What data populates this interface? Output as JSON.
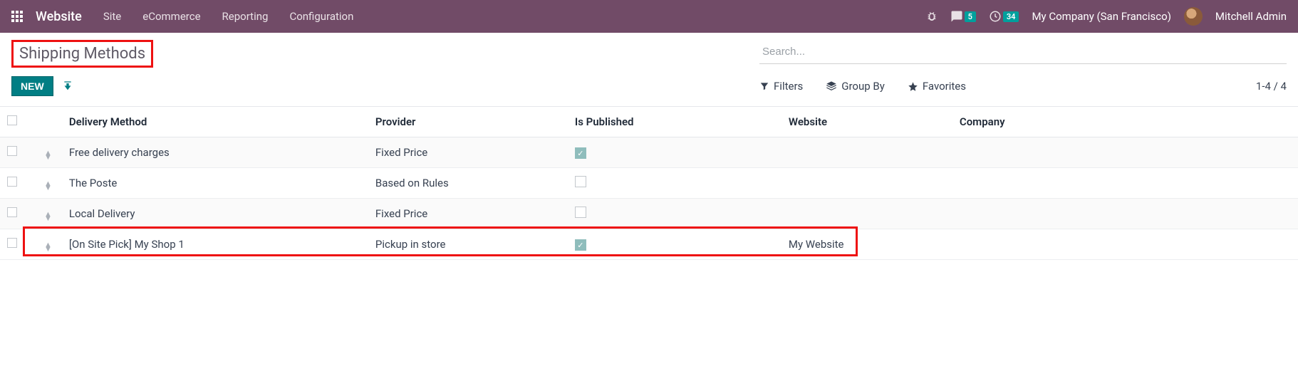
{
  "nav": {
    "brand": "Website",
    "items": [
      "Site",
      "eCommerce",
      "Reporting",
      "Configuration"
    ],
    "msg_badge": "5",
    "act_badge": "34",
    "company": "My Company (San Francisco)",
    "user": "Mitchell Admin"
  },
  "breadcrumb": "Shipping Methods",
  "btn_new": "NEW",
  "search": {
    "placeholder": "Search..."
  },
  "tools": {
    "filters": "Filters",
    "groupby": "Group By",
    "favorites": "Favorites"
  },
  "pager": "1-4 / 4",
  "columns": {
    "method": "Delivery Method",
    "provider": "Provider",
    "published": "Is Published",
    "website": "Website",
    "company": "Company"
  },
  "rows": [
    {
      "method": "Free delivery charges",
      "provider": "Fixed Price",
      "published": true,
      "website": "",
      "company": ""
    },
    {
      "method": "The Poste",
      "provider": "Based on Rules",
      "published": false,
      "website": "",
      "company": ""
    },
    {
      "method": "Local Delivery",
      "provider": "Fixed Price",
      "published": false,
      "website": "",
      "company": ""
    },
    {
      "method": "[On Site Pick] My Shop 1",
      "provider": "Pickup in store",
      "published": true,
      "website": "My Website",
      "company": ""
    }
  ]
}
